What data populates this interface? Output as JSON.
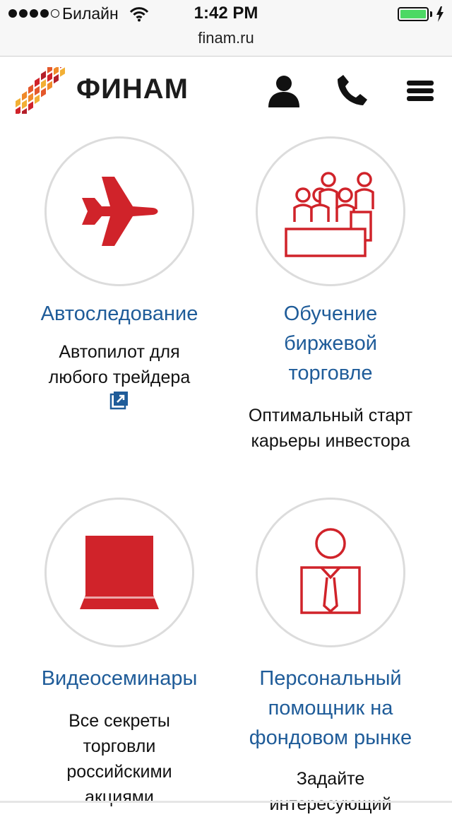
{
  "status_bar": {
    "carrier": "Билайн",
    "time": "1:42 PM",
    "signal_dots_filled": 4,
    "signal_dots_total": 5,
    "battery_level": 1.0,
    "icons": [
      "wifi-icon",
      "battery-icon",
      "charging-bolt-icon"
    ]
  },
  "browser": {
    "url": "finam.ru"
  },
  "header": {
    "brand": "ФИНАМ",
    "icons": [
      "account-icon",
      "phone-icon",
      "menu-icon"
    ]
  },
  "tiles": [
    {
      "icon": "airplane-icon",
      "title": "Автоследование",
      "desc": [
        "Автопилот для",
        "любого трейдера"
      ],
      "has_external_link": true
    },
    {
      "icon": "classroom-icon",
      "title": "Обучение биржевой торговле",
      "title_lines": [
        "Обучение",
        "биржевой",
        "торговле"
      ],
      "desc": [
        "Оптимальный старт",
        "карьеры инвестора"
      ]
    },
    {
      "icon": "monitor-icon",
      "title": "Видеосеминары",
      "desc": [
        "Все секреты",
        "торговли",
        "российскими",
        "акциями"
      ]
    },
    {
      "icon": "personal-assistant-icon",
      "title": "Персональный помощник на фондовом рынке",
      "title_lines": [
        "Персональный",
        "помощник на",
        "фондовом рынке"
      ],
      "desc": [
        "Задайте",
        "интересующий"
      ]
    }
  ],
  "colors": {
    "accent_red": "#d0232a",
    "link_blue": "#1f5c99",
    "battery_green": "#4cd964",
    "circle_border": "#dcdcdc"
  }
}
